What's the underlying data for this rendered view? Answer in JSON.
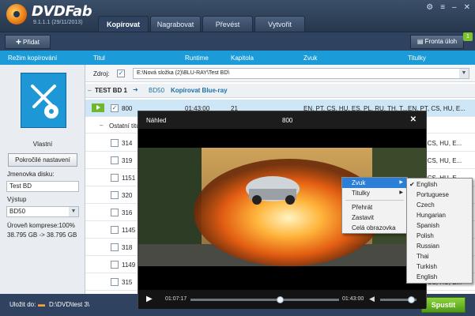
{
  "app": {
    "name": "DVDFab",
    "version": "9.1.1.1 (29/11/2013)",
    "tabs": [
      "Kopírovat",
      "Nagrabovat",
      "Převést",
      "Vytvořit"
    ],
    "active_tab": "Kopírovat"
  },
  "toolbar": {
    "add_label": "Přidat",
    "queue_label": "Fronta úloh",
    "queue_count": "1"
  },
  "columns": {
    "mode": "Režim kopírování",
    "title": "Titul",
    "runtime": "Runtime",
    "chapter": "Kapitola",
    "audio": "Zvuk",
    "subtitles": "Titulky"
  },
  "left_panel": {
    "mode_name": "Vlastní",
    "advanced_button": "Pokročilé nastavení",
    "volume_label": "Jmenovka disku:",
    "volume_value": "Test BD",
    "output_label": "Výstup",
    "output_value": "BD50",
    "compression": "Úroveň komprese:100%",
    "size": "38.795 GB -> 38.795 GB"
  },
  "source": {
    "label": "Zdroj:",
    "path": "E:\\Nová složka (2)\\BLU-RAY\\Test BD\\"
  },
  "title_group": {
    "name": "TEST BD 1",
    "type": "BD50",
    "action": "Kopírovat Blue-ray"
  },
  "main_title": {
    "number": "800",
    "runtime": "01:43:00",
    "chapters": "21",
    "audio": "EN, PT, CS, HU, ES, PL, RU, TH, T...",
    "subtitles": "EN, PT, CS, HU, E..."
  },
  "other_titles_label": "Ostatní titul",
  "titles": [
    {
      "number": "314",
      "subtitles": "...CS, HU, E..."
    },
    {
      "number": "319",
      "subtitles": "...CS, HU, E..."
    },
    {
      "number": "1151",
      "subtitles": "...CS, HU, E..."
    },
    {
      "number": "320",
      "subtitles": "...CS, HU, E..."
    },
    {
      "number": "316",
      "subtitles": "...CS, HU, E..."
    },
    {
      "number": "1145",
      "subtitles": "...CS, HU, E..."
    },
    {
      "number": "318",
      "subtitles": "...CS, HU, E..."
    },
    {
      "number": "1149",
      "subtitles": "...CS, HU, E..."
    },
    {
      "number": "315",
      "subtitles": "...CS, HU, E..."
    }
  ],
  "bottom": {
    "save_label": "Uložit do:",
    "save_path": "D:\\DVD\\test 3\\",
    "start_label": "Spustit"
  },
  "preview": {
    "title": "Náhled",
    "title_number": "800",
    "time_current": "01:07:17",
    "time_total": "01:43:00",
    "progress": 0.6,
    "volume": 0.85
  },
  "context_menu": {
    "items": [
      "Zvuk",
      "Titulky",
      "Přehrát",
      "Zastavit",
      "Celá obrazovka"
    ]
  },
  "audio_submenu": {
    "items": [
      "English",
      "Portuguese",
      "Czech",
      "Hungarian",
      "Spanish",
      "Polish",
      "Russian",
      "Thai",
      "Turkish",
      "English"
    ],
    "selected": "English"
  },
  "colors": {
    "header_blue": "#1b9bd8",
    "start_green": "#5aa91d",
    "menu_highlight": "#2b7fd6"
  }
}
